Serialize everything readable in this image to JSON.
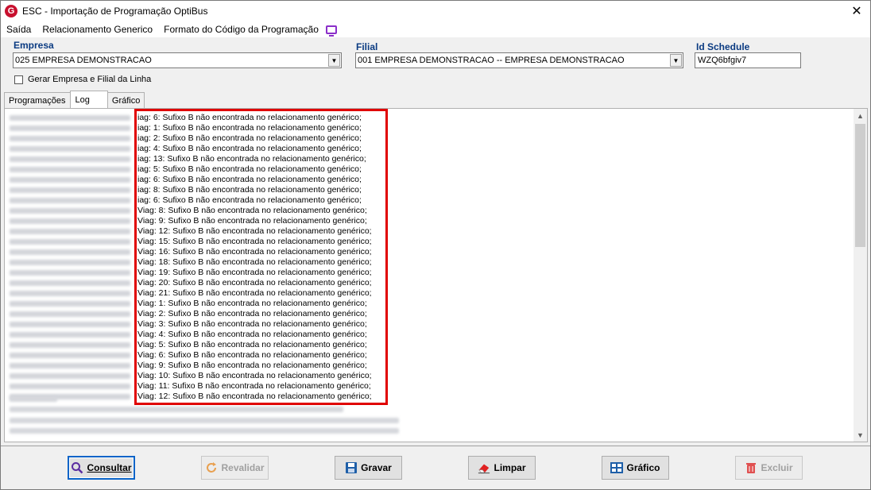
{
  "window": {
    "title": "ESC - Importação de Programação OptiBus",
    "close": "✕",
    "app_icon": "G"
  },
  "menu": [
    {
      "label": "Saída"
    },
    {
      "label": "Relacionamento Generico"
    },
    {
      "label": "Formato do Código da Programação"
    }
  ],
  "form": {
    "empresa_label": "Empresa",
    "empresa_value": "025 EMPRESA DEMONSTRACAO",
    "filial_label": "Filial",
    "filial_value": "001 EMPRESA DEMONSTRACAO -- EMPRESA DEMONSTRACAO",
    "schedule_label": "Id Schedule",
    "schedule_value": "WZQ6bfgiv7",
    "checkbox_label": "Gerar Empresa e Filial da Linha",
    "checkbox_checked": false
  },
  "tabs": [
    {
      "label": "Programações"
    },
    {
      "label": "Log",
      "active": true
    },
    {
      "label": "Gráfico"
    }
  ],
  "log_lines": [
    "iag: 6: Sufixo B não encontrada no relacionamento genérico;",
    "iag: 1: Sufixo B não encontrada no relacionamento genérico;",
    "iag: 2: Sufixo B não encontrada no relacionamento genérico;",
    "iag: 4: Sufixo B não encontrada no relacionamento genérico;",
    "iag: 13: Sufixo B não encontrada no relacionamento genérico;",
    "iag: 5: Sufixo B não encontrada no relacionamento genérico;",
    "iag: 6: Sufixo B não encontrada no relacionamento genérico;",
    "iag: 8: Sufixo B não encontrada no relacionamento genérico;",
    "iag: 6: Sufixo B não encontrada no relacionamento genérico;",
    "Viag: 8: Sufixo B não encontrada no relacionamento genérico;",
    "Viag: 9: Sufixo B não encontrada no relacionamento genérico;",
    "Viag: 12: Sufixo B não encontrada no relacionamento genérico;",
    "Viag: 15: Sufixo B não encontrada no relacionamento genérico;",
    "Viag: 16: Sufixo B não encontrada no relacionamento genérico;",
    "Viag: 18: Sufixo B não encontrada no relacionamento genérico;",
    "Viag: 19: Sufixo B não encontrada no relacionamento genérico;",
    "Viag: 20: Sufixo B não encontrada no relacionamento genérico;",
    "Viag: 21: Sufixo B não encontrada no relacionamento genérico;",
    "Viag: 1: Sufixo B não encontrada no relacionamento genérico;",
    "Viag: 2: Sufixo B não encontrada no relacionamento genérico;",
    "Viag: 3: Sufixo B não encontrada no relacionamento genérico;",
    "Viag: 4: Sufixo B não encontrada no relacionamento genérico;",
    "Viag: 5: Sufixo B não encontrada no relacionamento genérico;",
    "Viag: 6: Sufixo B não encontrada no relacionamento genérico;",
    "Viag: 9: Sufixo B não encontrada no relacionamento genérico;",
    "Viag: 10: Sufixo B não encontrada no relacionamento genérico;",
    "Viag: 11: Sufixo B não encontrada no relacionamento genérico;",
    "Viag: 12: Sufixo B não encontrada no relacionamento genérico;"
  ],
  "buttons": [
    {
      "label": "Consultar",
      "icon": "search-icon",
      "enabled": true,
      "focused": true
    },
    {
      "label": "Revalidar",
      "icon": "refresh-icon",
      "enabled": false
    },
    {
      "label": "Gravar",
      "icon": "save-icon",
      "enabled": true
    },
    {
      "label": "Limpar",
      "icon": "eraser-icon",
      "enabled": true
    },
    {
      "label": "Gráfico",
      "icon": "table-icon",
      "enabled": true
    },
    {
      "label": "Excluir",
      "icon": "trash-icon",
      "enabled": false
    }
  ],
  "colors": {
    "field_label": "#0b3b82",
    "highlight": "#e00000",
    "focus": "#0a64c8"
  }
}
